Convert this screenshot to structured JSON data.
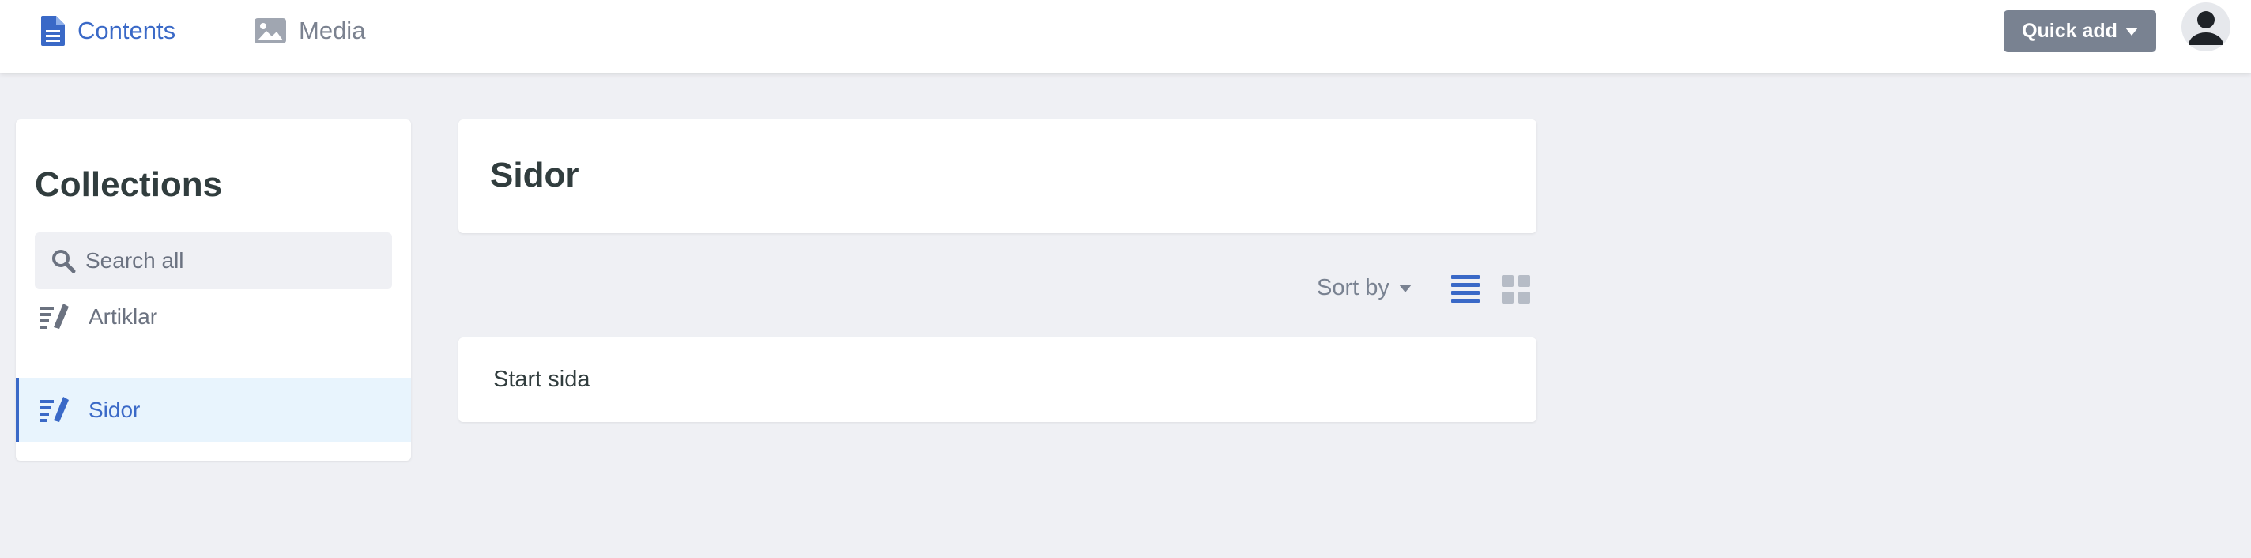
{
  "header": {
    "tabs": [
      {
        "label": "Contents",
        "icon": "document-icon",
        "active": true
      },
      {
        "label": "Media",
        "icon": "image-icon",
        "active": false
      }
    ],
    "quick_add_label": "Quick add",
    "avatar_icon": "user-icon"
  },
  "sidebar": {
    "title": "Collections",
    "search_placeholder": "Search all",
    "items": [
      {
        "label": "Artiklar",
        "icon": "edit-list-icon",
        "active": false
      },
      {
        "label": "Sidor",
        "icon": "edit-list-icon",
        "active": true
      }
    ]
  },
  "main": {
    "title": "Sidor",
    "sort_label": "Sort by",
    "view_modes": [
      "list",
      "grid"
    ],
    "active_view": "list",
    "entries": [
      {
        "title": "Start sida"
      }
    ]
  },
  "colors": {
    "accent": "#3a69c7",
    "muted": "#798291",
    "background": "#eff0f4",
    "active_item_bg": "#e8f4fd"
  }
}
